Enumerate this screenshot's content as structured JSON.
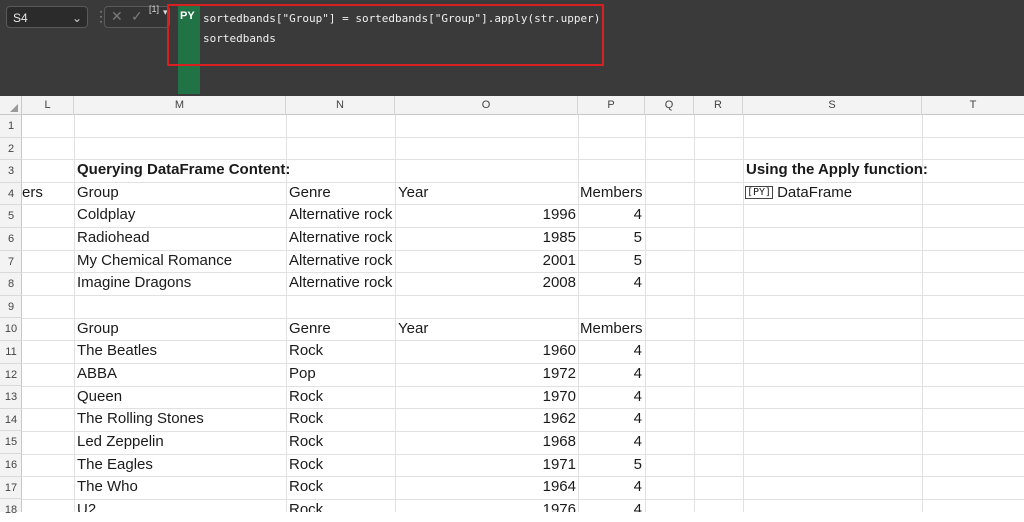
{
  "namebox": {
    "value": "S4"
  },
  "formula": {
    "mode": "PY",
    "lines": [
      "sortedbands[\"Group\"] = sortedbands[\"Group\"].apply(str.upper)",
      "sortedbands"
    ]
  },
  "columns": [
    "L",
    "M",
    "N",
    "O",
    "P",
    "Q",
    "R",
    "S",
    "T"
  ],
  "rows": [
    "1",
    "2",
    "3",
    "4",
    "5",
    "6",
    "7",
    "8",
    "9",
    "10",
    "11",
    "12",
    "13",
    "14",
    "15",
    "16",
    "17",
    "18"
  ],
  "sheet": {
    "title_left": "Querying DataFrame Content:",
    "title_right": "Using the Apply function:",
    "l4_partial": "ers",
    "s4_value": "DataFrame",
    "s4_icon": "[PY]",
    "headers": {
      "group": "Group",
      "genre": "Genre",
      "year": "Year",
      "members": "Members"
    },
    "table1": [
      [
        "Coldplay",
        "Alternative rock",
        "1996",
        "4"
      ],
      [
        "Radiohead",
        "Alternative rock",
        "1985",
        "5"
      ],
      [
        "My Chemical Romance",
        "Alternative rock",
        "2001",
        "5"
      ],
      [
        "Imagine Dragons",
        "Alternative rock",
        "2008",
        "4"
      ]
    ],
    "table2": [
      [
        "The Beatles",
        "Rock",
        "1960",
        "4"
      ],
      [
        "ABBA",
        "Pop",
        "1972",
        "4"
      ],
      [
        "Queen",
        "Rock",
        "1970",
        "4"
      ],
      [
        "The Rolling Stones",
        "Rock",
        "1962",
        "4"
      ],
      [
        "Led Zeppelin",
        "Rock",
        "1968",
        "4"
      ],
      [
        "The Eagles",
        "Rock",
        "1971",
        "5"
      ],
      [
        "The Who",
        "Rock",
        "1964",
        "4"
      ],
      [
        "U2",
        "Rock",
        "1976",
        "4"
      ]
    ]
  }
}
